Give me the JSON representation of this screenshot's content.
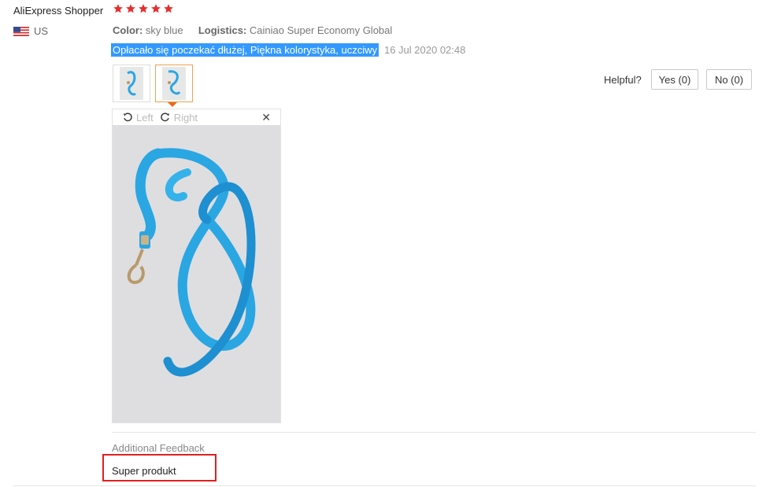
{
  "buyer": {
    "name": "AliExpress Shopper",
    "country": "US",
    "rating": 5
  },
  "review": {
    "color_label": "Color:",
    "color_value": "sky blue",
    "logistics_label": "Logistics:",
    "logistics_value": "Cainiao Super Economy Global",
    "text": "Opłacało się poczekać dłużej, Piękna kolorystyka, uczciwy",
    "date": "16 Jul 2020 02:48"
  },
  "helpful": {
    "label": "Helpful?",
    "yes": "Yes (0)",
    "no": "No (0)"
  },
  "viewer": {
    "left_label": "Left",
    "right_label": "Right",
    "close": "✕"
  },
  "additional": {
    "label": "Additional Feedback",
    "text": "Super produkt"
  },
  "colors": {
    "star": "#e62e2e",
    "highlight": "#3399ff",
    "lanyard": "#2aa6e3",
    "outline": "#e02020"
  }
}
